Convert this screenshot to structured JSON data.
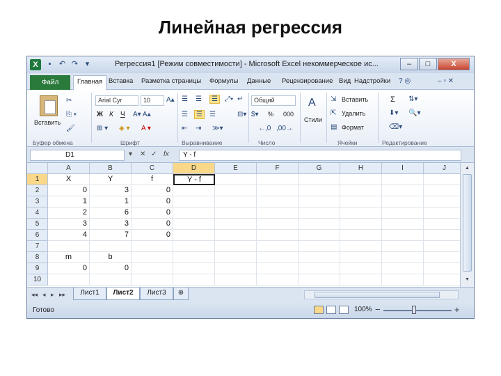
{
  "slide": {
    "title": "Линейная регрессия"
  },
  "window": {
    "title": "Регрессия1 [Режим совместимости] - Microsoft Excel некоммерческое ис...",
    "app_icon": "X",
    "quick_access": [
      "save-icon",
      "undo-icon",
      "redo-icon",
      "customize-icon"
    ],
    "controls": [
      "minimize-icon",
      "maximize-icon",
      "close-icon"
    ],
    "close_label": "X"
  },
  "ribbon_tabs": {
    "file": "Файл",
    "items": [
      "Главная",
      "Вставка",
      "Разметка страницы",
      "Формулы",
      "Данные",
      "Рецензирование",
      "Вид",
      "Надстройки"
    ],
    "active_index": 0
  },
  "ribbon": {
    "clipboard": {
      "paste": "Вставить",
      "label": "Буфер обмена"
    },
    "font": {
      "name": "Arial Cyr",
      "size": "10",
      "bold": "Ж",
      "italic": "К",
      "underline": "Ч",
      "label": "Шрифт"
    },
    "alignment": {
      "label": "Выравнивание"
    },
    "number": {
      "format": "Общий",
      "percent": "%",
      "thousands": "000",
      "label": "Число"
    },
    "styles": {
      "button": "Стили"
    },
    "cells": {
      "insert": "Вставить",
      "delete": "Удалить",
      "format": "Формат",
      "label": "Ячейки"
    },
    "editing": {
      "sum": "Σ",
      "label": "Редактирование"
    }
  },
  "formula_bar": {
    "name_box": "D1",
    "fx": "fx",
    "formula": "Y - f"
  },
  "grid": {
    "columns": [
      "A",
      "B",
      "C",
      "D",
      "E",
      "F",
      "G",
      "H",
      "I",
      "J"
    ],
    "selected_column": "D",
    "selected_row": "1",
    "rows": [
      {
        "num": "1",
        "cells": [
          "X",
          "Y",
          "f",
          "Y - f",
          "",
          "",
          "",
          "",
          "",
          ""
        ]
      },
      {
        "num": "2",
        "cells": [
          "0",
          "3",
          "0",
          "",
          "",
          "",
          "",
          "",
          "",
          ""
        ]
      },
      {
        "num": "3",
        "cells": [
          "1",
          "1",
          "0",
          "",
          "",
          "",
          "",
          "",
          "",
          ""
        ]
      },
      {
        "num": "4",
        "cells": [
          "2",
          "6",
          "0",
          "",
          "",
          "",
          "",
          "",
          "",
          ""
        ]
      },
      {
        "num": "5",
        "cells": [
          "3",
          "3",
          "0",
          "",
          "",
          "",
          "",
          "",
          "",
          ""
        ]
      },
      {
        "num": "6",
        "cells": [
          "4",
          "7",
          "0",
          "",
          "",
          "",
          "",
          "",
          "",
          ""
        ]
      },
      {
        "num": "7",
        "cells": [
          "",
          "",
          "",
          "",
          "",
          "",
          "",
          "",
          "",
          ""
        ]
      },
      {
        "num": "8",
        "cells": [
          "m",
          "b",
          "",
          "",
          "",
          "",
          "",
          "",
          "",
          ""
        ]
      },
      {
        "num": "9",
        "cells": [
          "0",
          "0",
          "",
          "",
          "",
          "",
          "",
          "",
          "",
          ""
        ]
      },
      {
        "num": "10",
        "cells": [
          "",
          "",
          "",
          "",
          "",
          "",
          "",
          "",
          "",
          ""
        ]
      }
    ]
  },
  "sheets": {
    "tabs": [
      "Лист1",
      "Лист2",
      "Лист3"
    ],
    "active_index": 1
  },
  "status_bar": {
    "status": "Готово",
    "zoom": "100%",
    "zoom_minus": "−",
    "zoom_plus": "+"
  }
}
